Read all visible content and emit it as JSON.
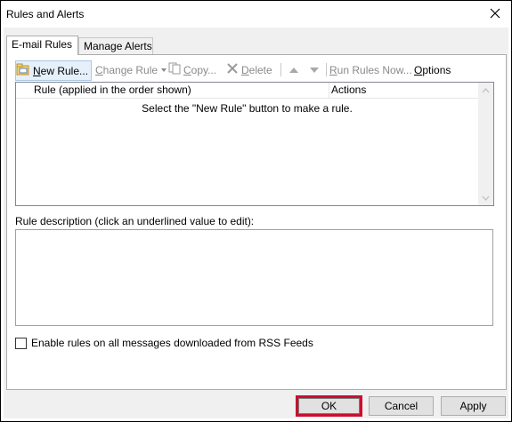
{
  "window": {
    "title": "Rules and Alerts"
  },
  "tabs": [
    {
      "label": "E-mail Rules",
      "active": true
    },
    {
      "label": "Manage Alerts",
      "active": false
    }
  ],
  "toolbar": {
    "new_rule": {
      "prefix": "N",
      "rest": "ew Rule..."
    },
    "change_rule": {
      "prefix": "",
      "u": "C",
      "rest": "hange Rule"
    },
    "copy": {
      "u": "C",
      "rest": "opy..."
    },
    "delete": {
      "u": "D",
      "rest": "elete"
    },
    "run_rules": {
      "u": "R",
      "rest": "un Rules Now..."
    },
    "options": {
      "u": "O",
      "rest": "ptions"
    }
  },
  "rules_list": {
    "columns": [
      "Rule (applied in the order shown)",
      "Actions"
    ],
    "empty_message": "Select the \"New Rule\" button to make a rule.",
    "rows": []
  },
  "description": {
    "label": "Rule description (click an underlined value to edit):",
    "text": ""
  },
  "rss_option": {
    "label": "Enable rules on all messages downloaded from RSS Feeds",
    "checked": false
  },
  "buttons": {
    "ok": "OK",
    "cancel": "Cancel",
    "apply": "Apply"
  },
  "colors": {
    "highlight_border": "#c8102e",
    "hot_button_bg": "#e6f0fa",
    "hot_button_border": "#aac7e4",
    "dialog_bg": "#f0f0f0"
  }
}
